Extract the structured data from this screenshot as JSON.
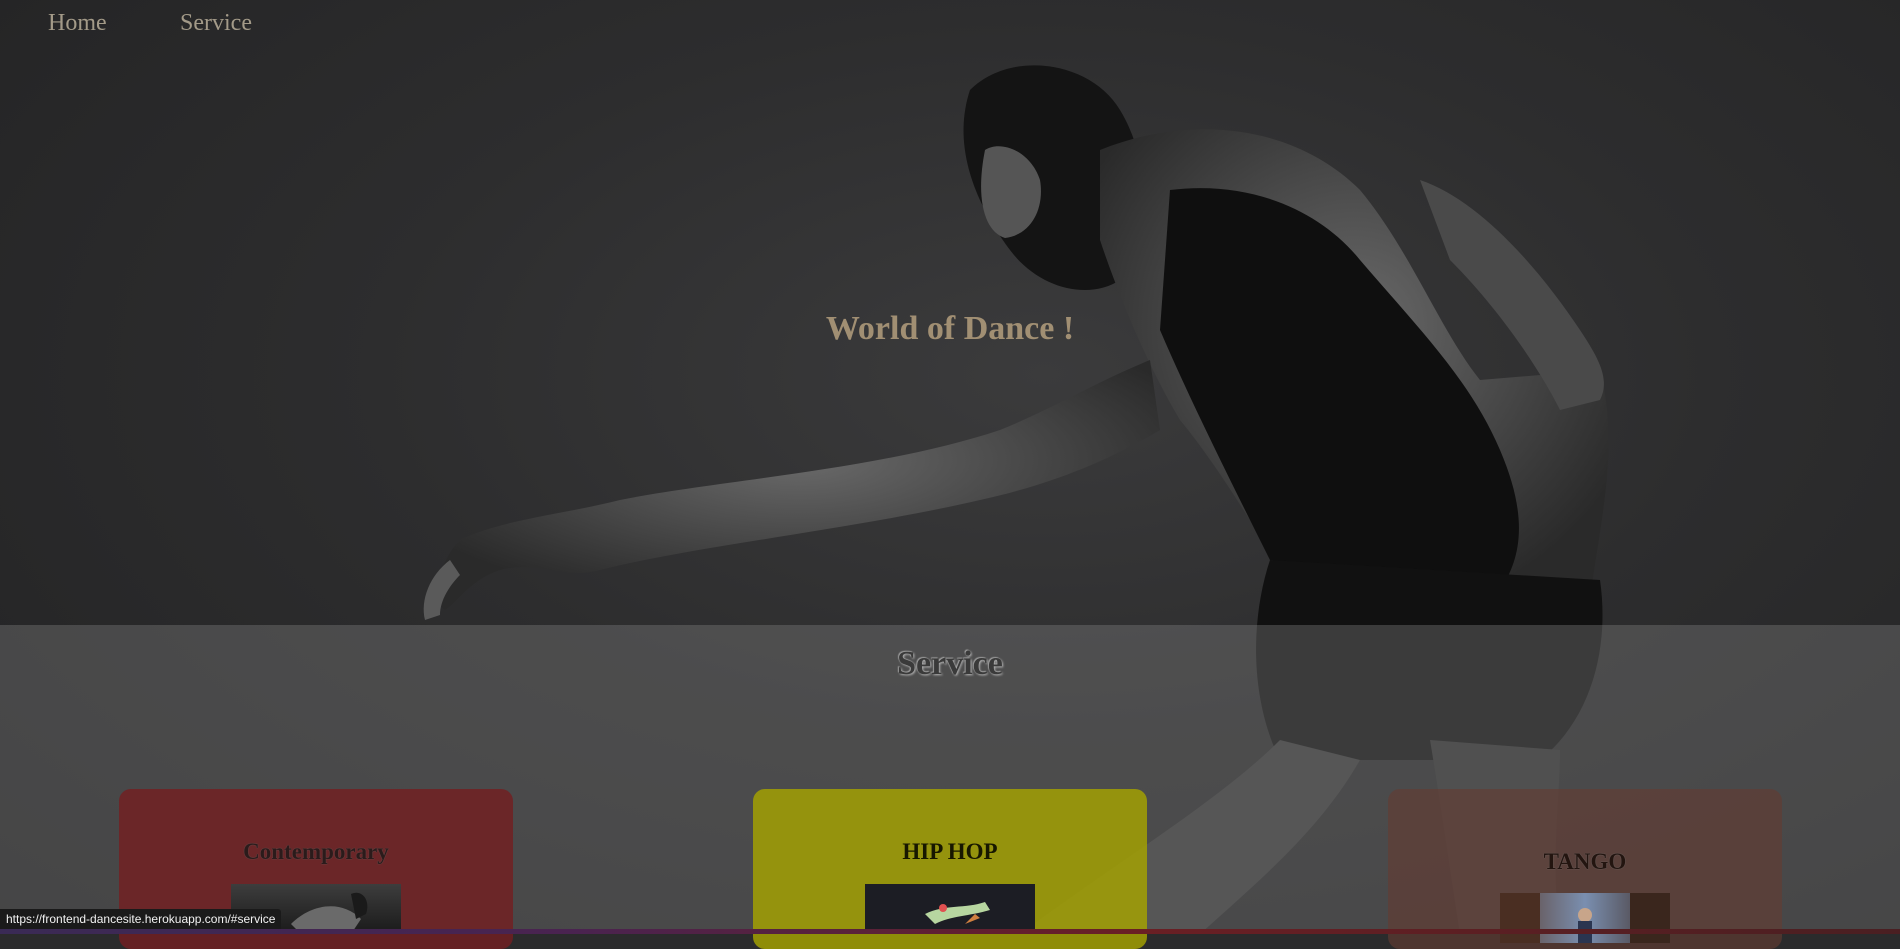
{
  "nav": {
    "home_label": "Home",
    "service_label": "Service"
  },
  "hero": {
    "title": "World of Dance !"
  },
  "service": {
    "title": "Service",
    "cards": [
      {
        "title": "Contemporary",
        "color": "#731e21"
      },
      {
        "title": "HIP HOP",
        "color": "#a6a300"
      },
      {
        "title": "TANGO",
        "color": "#643c32"
      }
    ]
  },
  "status_bar": {
    "url": "https://frontend-dancesite.herokuapp.com/#service"
  },
  "colors": {
    "nav_text": "#a39a88",
    "hero_title": "#a18f73",
    "background": "#2b2b2c"
  }
}
